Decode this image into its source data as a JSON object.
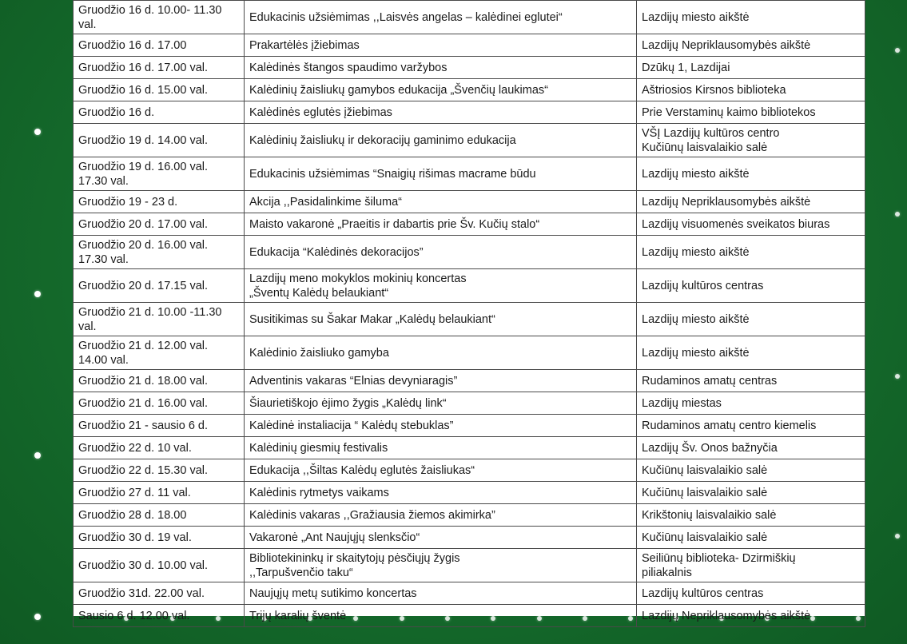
{
  "rows": [
    {
      "date": "Gruodžio 16 d.  10.00- 11.30\nval.",
      "event": "Edukacinis užsiėmimas ,,Laisvės  angelas – kalėdinei eglutei“",
      "place": "Lazdijų miesto aikštė",
      "h": 2
    },
    {
      "date": "Gruodžio 16 d.  17.00",
      "event": "Prakartėlės įžiebimas",
      "place": "Lazdijų Nepriklausomybės aikštė",
      "h": 1
    },
    {
      "date": "Gruodžio 16 d.  17.00 val.",
      "event": "Kalėdinės štangos spaudimo varžybos",
      "place": "Dzūkų 1, Lazdijai",
      "h": 1
    },
    {
      "date": "Gruodžio 16  d.  15.00 val.",
      "event": "Kalėdinių žaisliukų gamybos edukacija „Švenčių laukimas“",
      "place": "Aštriosios Kirsnos biblioteka",
      "h": 1
    },
    {
      "date": "Gruodžio 16 d.",
      "event": "Kalėdinės eglutės įžiebimas",
      "place": "Prie Verstaminų kaimo bibliotekos",
      "h": 1
    },
    {
      "date": "Gruodžio 19 d.  14.00 val.",
      "event": "Kalėdinių žaisliukų ir dekoracijų gaminimo edukacija",
      "place": "VŠĮ Lazdijų kultūros centro\nKučiūnų laisvalaikio salė",
      "h": 2
    },
    {
      "date": "Gruodžio 19 d.  16.00 val.\n17.30 val.",
      "event": "Edukacinis užsiėmimas “Snaigių rišimas macrame būdu",
      "place": "Lazdijų miesto aikštė",
      "h": 2
    },
    {
      "date": "Gruodžio 19 - 23 d.",
      "event": "Akcija  ,,Pasidalinkime šiluma“",
      "place": "Lazdijų Nepriklausomybės aikštė",
      "h": 1
    },
    {
      "date": "Gruodžio 20 d. 17.00 val.",
      "event": "Maisto vakaronė „Praeitis ir dabartis prie Šv. Kučių stalo“",
      "place": "Lazdijų visuomenės sveikatos biuras",
      "h": 1
    },
    {
      "date": "Gruodžio 20 d.  16.00 val.\n17.30 val.",
      "event": "Edukacija “Kalėdinės dekoracijos”",
      "place": "Lazdijų miesto aikštė",
      "h": 2
    },
    {
      "date": "Gruodžio 20 d.  17.15 val.",
      "event": "Lazdijų meno mokyklos mokinių koncertas\n„Šventų Kalėdų belaukiant“",
      "place": "Lazdijų kultūros centras",
      "h": 2
    },
    {
      "date": "Gruodžio 21 d.  10.00 -11.30\nval.",
      "event": "Susitikimas su Šakar Makar „Kalėdų belaukiant“",
      "place": "Lazdijų  miesto aikštė",
      "h": 2
    },
    {
      "date": "Gruodžio 21 d.  12.00 val.\n14.00 val.",
      "event": "Kalėdinio žaisliuko gamyba",
      "place": "Lazdijų miesto aikštė",
      "h": 2
    },
    {
      "date": "Gruodžio 21 d.  18.00 val.",
      "event": "Adventinis vakaras  “Elnias devyniaragis”",
      "place": "Rudaminos amatų centras",
      "h": 1
    },
    {
      "date": "Gruodžio 21 d.  16.00 val.",
      "event": "Šiaurietiškojo ėjimo žygis „Kalėdų link“",
      "place": "Lazdijų miestas",
      "h": 1
    },
    {
      "date": "Gruodžio 21 - sausio 6 d.",
      "event": "Kalėdinė instaliacija “ Kalėdų stebuklas”",
      "place": "Rudaminos amatų centro kiemelis",
      "h": 1
    },
    {
      "date": "Gruodžio 22 d.  10 val.",
      "event": "Kalėdinių giesmių festivalis",
      "place": "Lazdijų Šv. Onos bažnyčia",
      "h": 1
    },
    {
      "date": "Gruodžio 22 d.  15.30 val.",
      "event": "Edukacija ,,Šiltas Kalėdų eglutės žaisliukas“",
      "place": "Kučiūnų laisvalaikio salė",
      "h": 1
    },
    {
      "date": "Gruodžio 27 d.  11 val.",
      "event": "Kalėdinis rytmetys vaikams",
      "place": "Kučiūnų laisvalaikio salė",
      "h": 1
    },
    {
      "date": "Gruodžio 28 d.  18.00",
      "event": "Kalėdinis vakaras ,,Gražiausia žiemos akimirka”",
      "place": "Krikštonių laisvalaikio salė",
      "h": 1
    },
    {
      "date": "Gruodžio 30 d.  19 val.",
      "event": "Vakaronė  „Ant Naujųjų slenksčio“",
      "place": "Kučiūnų laisvalaikio salė",
      "h": 1
    },
    {
      "date": "Gruodžio 30 d.  10.00 val.",
      "event": "Bibliotekininkų ir skaitytojų pėsčiųjų žygis\n,,Tarpušvenčio taku“",
      "place": "Seiliūnų biblioteka-  Dzirmiškių\npiliakalnis",
      "h": 2
    },
    {
      "date": "Gruodžio 31d.  22.00 val.",
      "event": "Naujųjų metų sutikimo koncertas",
      "place": "Lazdijų kultūros centras",
      "h": 1
    },
    {
      "date": "Sausio 6 d.  12.00 val.",
      "event": "Trijų karalių šventė",
      "place": "Lazdijų Nepriklausomybės aikštė",
      "h": 1
    }
  ],
  "colors": {
    "background": "#156b2c",
    "table_background": "#ffffff",
    "border": "#4a4a4a",
    "snow": "#ffffff"
  }
}
